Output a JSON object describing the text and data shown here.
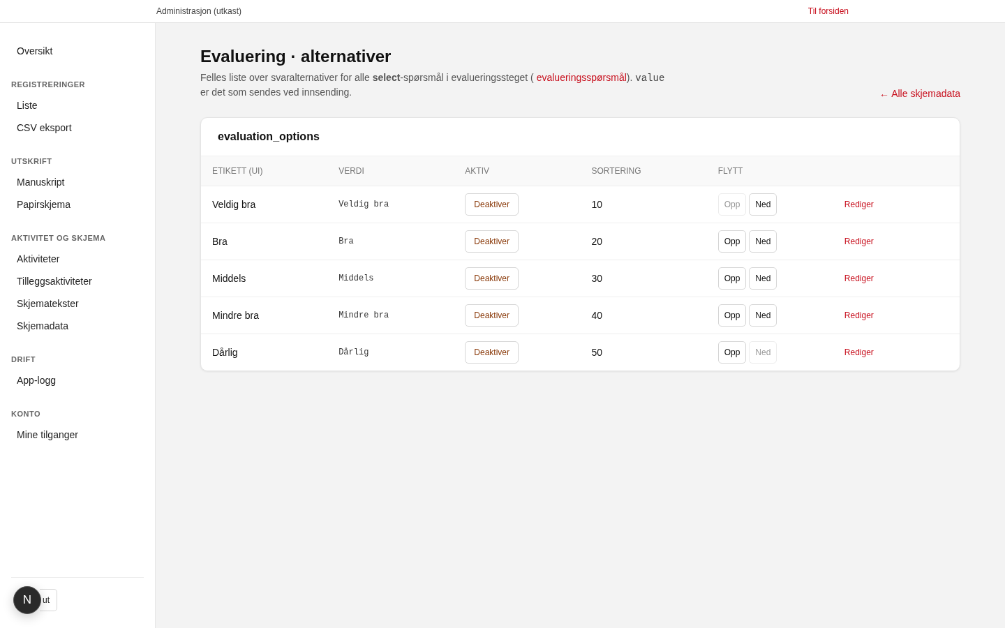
{
  "top_bar": {
    "title": "Administrasjon (utkast)",
    "home_link": "Til forsiden"
  },
  "sidebar": {
    "sections": [
      {
        "items": [
          {
            "label": "Oversikt",
            "selected": false
          }
        ]
      },
      {
        "heading": "REGISTRERINGER",
        "items": [
          {
            "label": "Liste",
            "selected": false
          },
          {
            "label": "CSV eksport",
            "selected": false
          }
        ]
      },
      {
        "heading": "UTSKRIFT",
        "items": [
          {
            "label": "Manuskript",
            "selected": false
          },
          {
            "label": "Papirskjema",
            "selected": false
          }
        ]
      },
      {
        "heading": "AKTIVITET OG SKJEMA",
        "items": [
          {
            "label": "Aktiviteter",
            "selected": false
          },
          {
            "label": "Tilleggsaktiviteter",
            "selected": false
          },
          {
            "label": "Skjematekster",
            "selected": false
          },
          {
            "label": "Skjemadata",
            "selected": false
          }
        ]
      },
      {
        "heading": "DRIFT",
        "items": [
          {
            "label": "App-logg",
            "selected": false
          }
        ]
      },
      {
        "heading": "KONTO",
        "items": [
          {
            "label": "Mine tilganger",
            "selected": false
          }
        ]
      }
    ],
    "logout_button": "ut",
    "badge": "N"
  },
  "page": {
    "title": "Evaluering · alternativer",
    "description": "Felles liste over svaralternativer for alle **select**-spørsmål i evalueringssteget ( ",
    "description_link": "evalueringsspørsmål",
    "description_after": "). ",
    "description_code": "value",
    "description_end": "er det som sendes ved innsending.",
    "back_link": "← Alle skjemadata"
  },
  "table": {
    "title": "evaluation_options",
    "columns": [
      "ETIKETT (UI)",
      "VERDI",
      "AKTIV",
      "SORTERING",
      "FLYTT"
    ],
    "rows": [
      {
        "label": "Veldig bra",
        "value": "Veldig bra",
        "toggle": "Deaktiver",
        "sort": "10",
        "up": "Opp",
        "up_disabled": true,
        "down": "Ned",
        "down_disabled": false,
        "edit": "Rediger"
      },
      {
        "label": "Bra",
        "value": "Bra",
        "toggle": "Deaktiver",
        "sort": "20",
        "up": "Opp",
        "up_disabled": false,
        "down": "Ned",
        "down_disabled": false,
        "edit": "Rediger"
      },
      {
        "label": "Middels",
        "value": "Middels",
        "toggle": "Deaktiver",
        "sort": "30",
        "up": "Opp",
        "up_disabled": false,
        "down": "Ned",
        "down_disabled": false,
        "edit": "Rediger"
      },
      {
        "label": "Mindre bra",
        "value": "Mindre bra",
        "toggle": "Deaktiver",
        "sort": "40",
        "up": "Opp",
        "up_disabled": false,
        "down": "Ned",
        "down_disabled": false,
        "edit": "Rediger"
      },
      {
        "label": "Dårlig",
        "value": "Dårlig",
        "toggle": "Deaktiver",
        "sort": "50",
        "up": "Opp",
        "up_disabled": false,
        "down": "Ned",
        "down_disabled": true,
        "edit": "Rediger"
      }
    ]
  }
}
